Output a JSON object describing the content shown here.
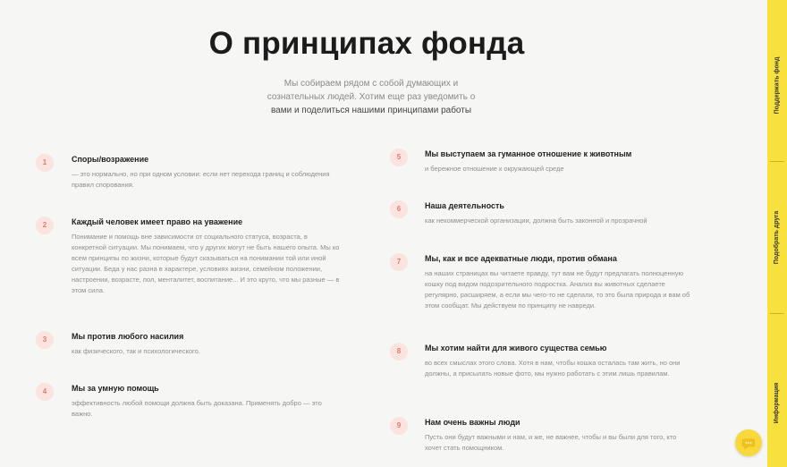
{
  "title": "О принципах фонда",
  "intro": {
    "line1": "Мы собираем рядом с собой думающих и",
    "line2": "сознательных людей. Хотим еще раз уведомить о",
    "line3": "вами и поделиться нашими принципами работы"
  },
  "principles": [
    {
      "num": "1",
      "title": "Споры/возражение",
      "text": "— это нормально, но при одном условии: если нет перехода границ и соблюдения правил спорования."
    },
    {
      "num": "2",
      "title": "Каждый человек имеет право на уважение",
      "text": "Понимание и помощь вне зависимости от социального статуса, возраста, в конкретной ситуации. Мы понимаем, что у других могут не быть нашего опыта. Мы ко всем принципы по жизни, которые будут сказываться на понимании той или иной ситуации. Беда у нас разна в характере, условиях жизни, семейном положении, настроении, возрасте, пол, менталитет, воспитание... И это круто, что мы разные — в этом сила."
    },
    {
      "num": "3",
      "title": "Мы против любого насилия",
      "text": "как физического, так и психологического."
    },
    {
      "num": "4",
      "title": "Мы за умную помощь",
      "text": "эффективность любой помощи должна быть доказана. Применять добро — это важно."
    },
    {
      "num": "5",
      "title": "Мы выступаем за гуманное отношение к животным",
      "text": "и бережное отношение к окружающей среде"
    },
    {
      "num": "6",
      "title": "Наша деятельность",
      "text": "как некоммерческой организации, должна быть законной и прозрачной"
    },
    {
      "num": "7",
      "title": "Мы, как и все адекватные люди, против обмана",
      "text": "на наших страницах вы читаете правду, тут вам не будут предлагать полноценную кошку под видом подозрительного подростка. Анализ вы животных сделаете регулярно, расширяем, а если мы чего-то не сделали, то это была природа и вам об этом сообщат. Мы действуем по принципу не навреди."
    },
    {
      "num": "8",
      "title": "Мы хотим найти для живого существа семью",
      "text": "во всех смыслах этого слова. Хотя в нам, чтобы кошка осталась там жить, но они должны, а присылать новые фото, мы нужно работать с этим лишь правилам."
    },
    {
      "num": "9",
      "title": "Нам очень важны люди",
      "text": "Пусть они будут важными и нам, и же, не важнее, чтобы и вы были для того, кто хочет стать помощником."
    }
  ],
  "sidebar": {
    "tab1": "Поддержать фонд",
    "tab2": "Подобрать друга",
    "tab3": "Информация"
  },
  "colors": {
    "accent": "#f8e13d",
    "badge_bg": "#fbe3df",
    "badge_text": "#e07c70"
  },
  "icons": {
    "chat": "chat-bubble-icon"
  }
}
